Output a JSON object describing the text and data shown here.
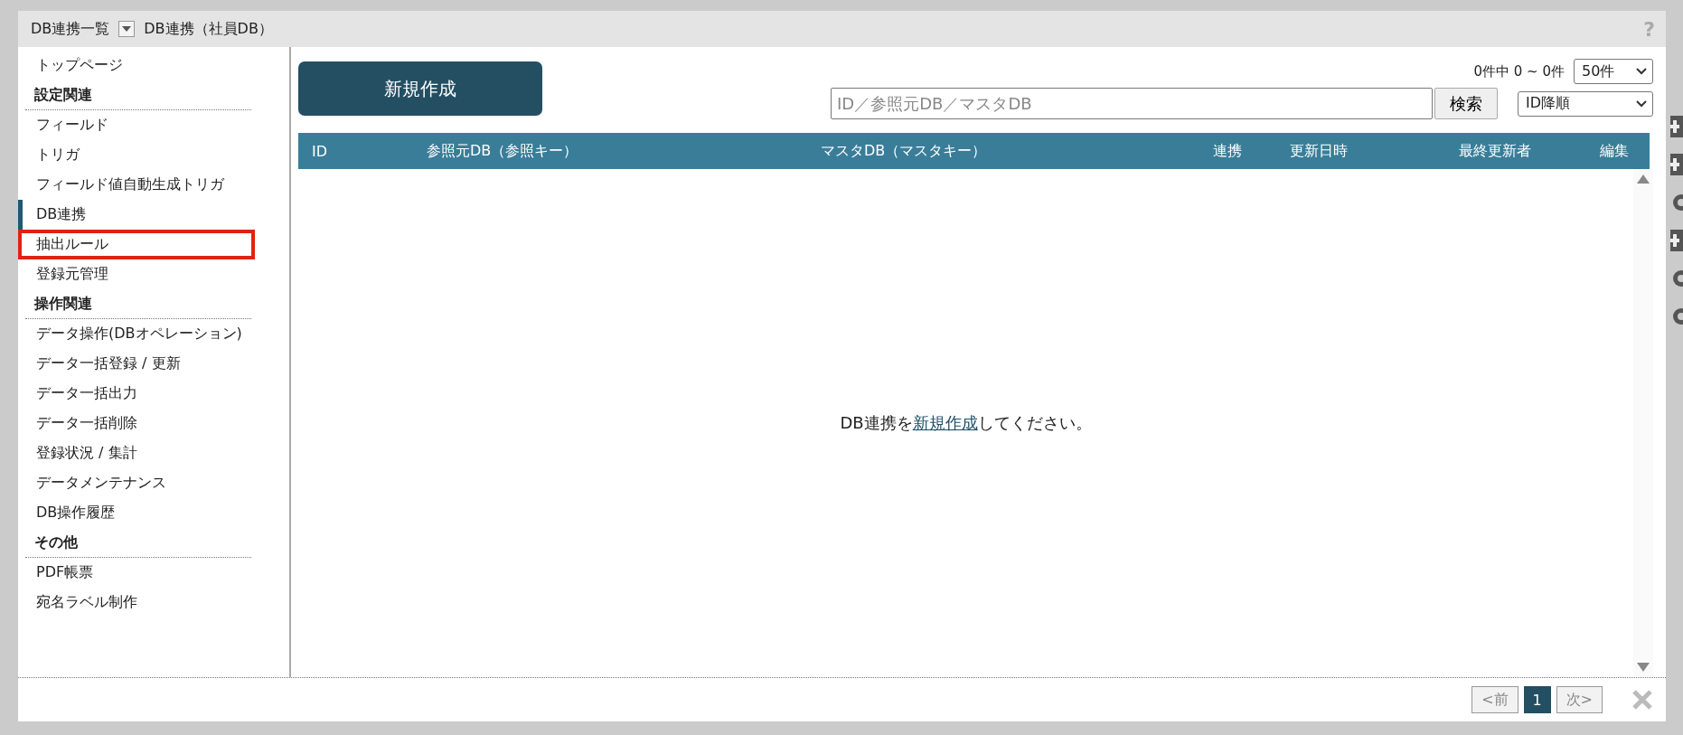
{
  "header": {
    "list_title": "DB連携一覧",
    "db_title": "DB連携（社員DB）",
    "help": "?"
  },
  "sidebar": {
    "items": [
      {
        "kind": "link",
        "label": "トップページ",
        "selected": false,
        "highlighted": false
      },
      {
        "kind": "heading",
        "label": "設定関連"
      },
      {
        "kind": "link",
        "label": "フィールド",
        "selected": false,
        "highlighted": false
      },
      {
        "kind": "link",
        "label": "トリガ",
        "selected": false,
        "highlighted": false
      },
      {
        "kind": "link",
        "label": "フィールド値自動生成トリガ",
        "selected": false,
        "highlighted": false
      },
      {
        "kind": "link",
        "label": "DB連携",
        "selected": true,
        "highlighted": false
      },
      {
        "kind": "link",
        "label": "抽出ルール",
        "selected": false,
        "highlighted": true
      },
      {
        "kind": "link",
        "label": "登録元管理",
        "selected": false,
        "highlighted": false
      },
      {
        "kind": "heading",
        "label": "操作関連"
      },
      {
        "kind": "link",
        "label": "データ操作(DBオペレーション)",
        "selected": false,
        "highlighted": false
      },
      {
        "kind": "link",
        "label": "データ一括登録 / 更新",
        "selected": false,
        "highlighted": false
      },
      {
        "kind": "link",
        "label": "データ一括出力",
        "selected": false,
        "highlighted": false
      },
      {
        "kind": "link",
        "label": "データ一括削除",
        "selected": false,
        "highlighted": false
      },
      {
        "kind": "link",
        "label": "登録状況 / 集計",
        "selected": false,
        "highlighted": false
      },
      {
        "kind": "link",
        "label": "データメンテナンス",
        "selected": false,
        "highlighted": false
      },
      {
        "kind": "link",
        "label": "DB操作履歴",
        "selected": false,
        "highlighted": false
      },
      {
        "kind": "heading",
        "label": "その他"
      },
      {
        "kind": "link",
        "label": "PDF帳票",
        "selected": false,
        "highlighted": false
      },
      {
        "kind": "link",
        "label": "宛名ラベル制作",
        "selected": false,
        "highlighted": false
      }
    ]
  },
  "toolbar": {
    "new_button": "新規作成",
    "count": "0件中 0 ~ 0件",
    "per_page": "50件",
    "search": {
      "placeholder": "ID／参照元DB／マスタDB"
    },
    "search_button": "検索",
    "sort": "ID降順"
  },
  "table": {
    "columns": [
      "ID",
      "参照元DB（参照キー）",
      "マスタDB（マスタキー）",
      "連携",
      "更新日時",
      "最終更新者",
      "編集"
    ]
  },
  "empty_message": {
    "before": "DB連携を",
    "link": "新規作成",
    "after": "してください。"
  },
  "pagination": {
    "prev": "<前",
    "pages": [
      {
        "label": "1",
        "selected": true
      }
    ],
    "next": "次>"
  }
}
